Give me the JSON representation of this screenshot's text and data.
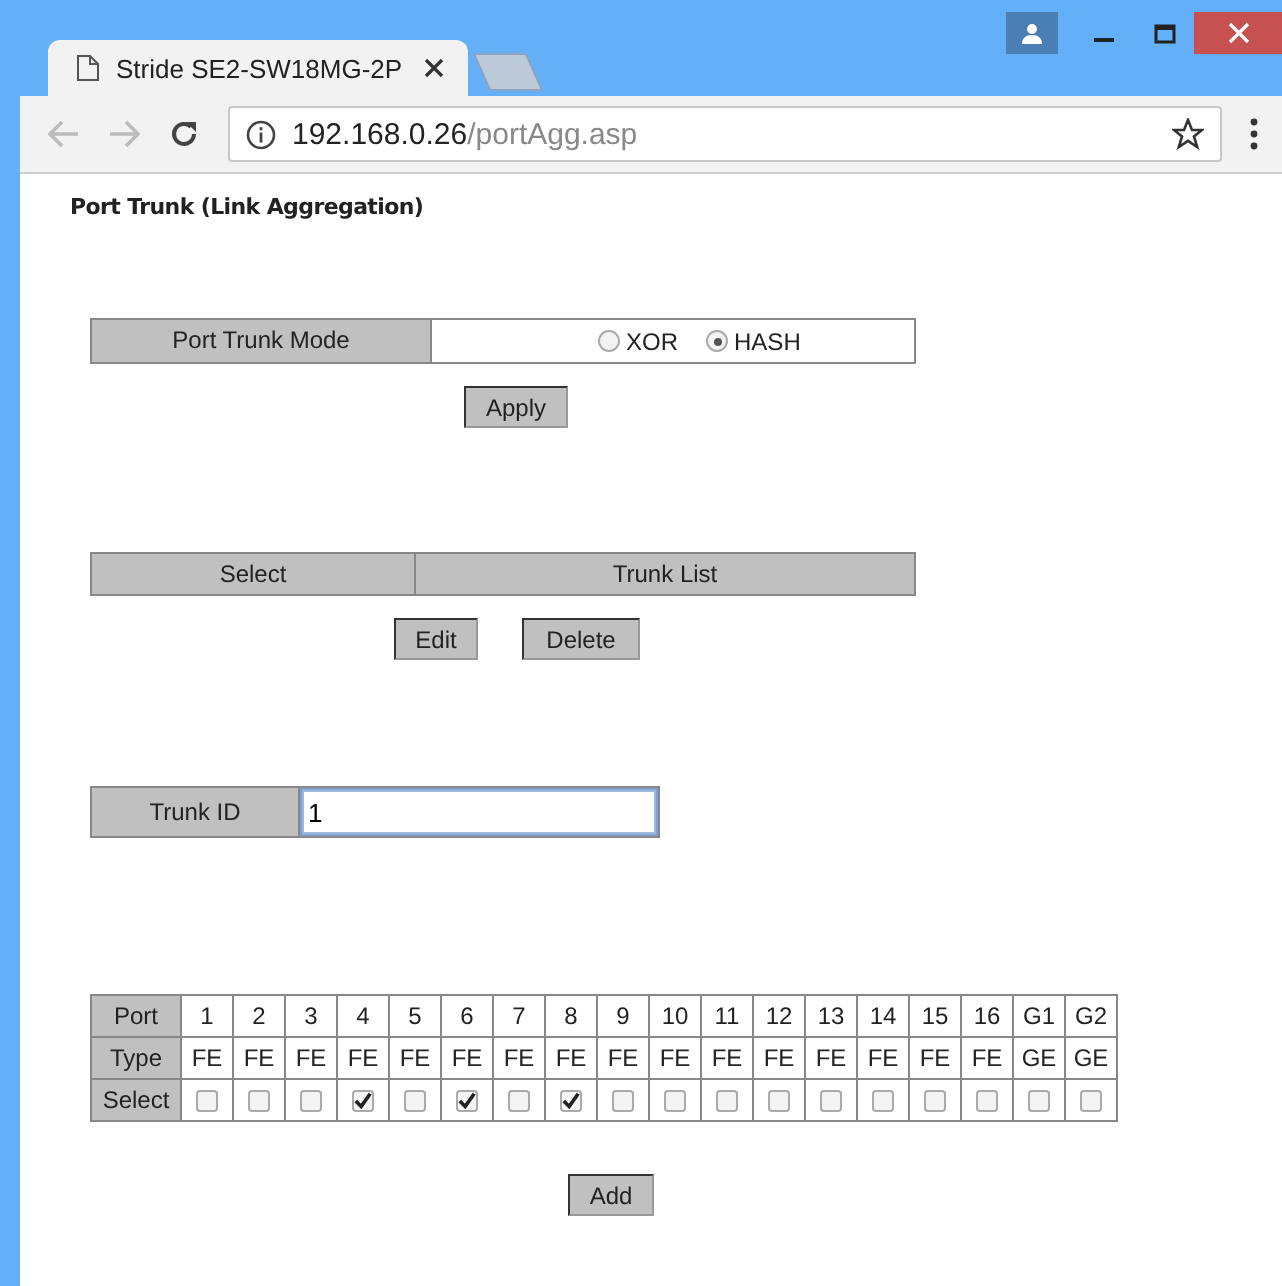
{
  "browser": {
    "tab_title": "Stride SE2-SW18MG-2P",
    "address_host": "192.168.0.26",
    "address_path": "/portAgg.asp"
  },
  "page_title": "Port Trunk (Link Aggregation)",
  "mode": {
    "label": "Port Trunk Mode",
    "options": [
      {
        "label": "XOR",
        "selected": false
      },
      {
        "label": "HASH",
        "selected": true
      }
    ],
    "button": "Apply"
  },
  "trunk_list": {
    "columns": [
      "Select",
      "Trunk List"
    ],
    "buttons": [
      "Edit",
      "Delete"
    ]
  },
  "trunk_id": {
    "label": "Trunk ID",
    "value": "1"
  },
  "ports": {
    "row_labels": [
      "Port",
      "Type",
      "Select"
    ],
    "items": [
      {
        "port": "1",
        "type": "FE",
        "checked": false
      },
      {
        "port": "2",
        "type": "FE",
        "checked": false
      },
      {
        "port": "3",
        "type": "FE",
        "checked": false
      },
      {
        "port": "4",
        "type": "FE",
        "checked": true
      },
      {
        "port": "5",
        "type": "FE",
        "checked": false
      },
      {
        "port": "6",
        "type": "FE",
        "checked": true
      },
      {
        "port": "7",
        "type": "FE",
        "checked": false
      },
      {
        "port": "8",
        "type": "FE",
        "checked": true
      },
      {
        "port": "9",
        "type": "FE",
        "checked": false
      },
      {
        "port": "10",
        "type": "FE",
        "checked": false
      },
      {
        "port": "11",
        "type": "FE",
        "checked": false
      },
      {
        "port": "12",
        "type": "FE",
        "checked": false
      },
      {
        "port": "13",
        "type": "FE",
        "checked": false
      },
      {
        "port": "14",
        "type": "FE",
        "checked": false
      },
      {
        "port": "15",
        "type": "FE",
        "checked": false
      },
      {
        "port": "16",
        "type": "FE",
        "checked": false
      },
      {
        "port": "G1",
        "type": "GE",
        "checked": false
      },
      {
        "port": "G2",
        "type": "GE",
        "checked": false
      }
    ]
  },
  "add_button": "Add"
}
